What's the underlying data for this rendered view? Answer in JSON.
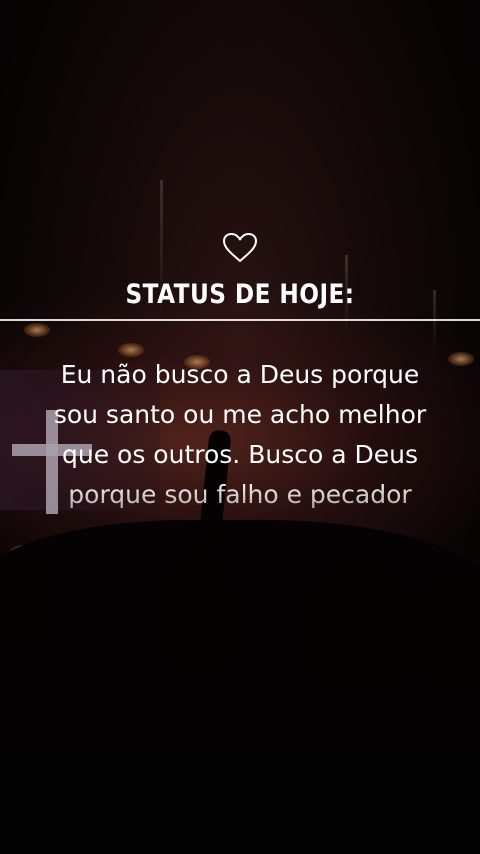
{
  "status_card": {
    "icon": "heart-outline-icon",
    "title": "STATUS DE HOJE:",
    "message": "Eu não busco a Deus porque sou santo ou me acho melhor que os outros. Busco a Deus porque sou falho e pecador"
  },
  "colors": {
    "text": "#ffffff",
    "background": "#0a0607"
  }
}
